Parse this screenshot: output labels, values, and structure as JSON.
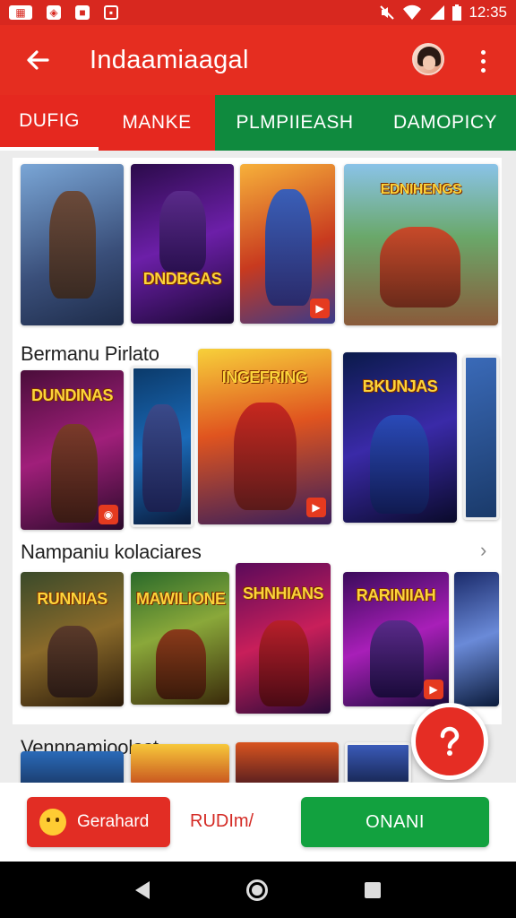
{
  "status_bar": {
    "time": "12:35",
    "left_icons": [
      "notification-icon-1",
      "notification-icon-2",
      "notification-icon-3",
      "image-icon"
    ],
    "right_icons": [
      "mute-icon",
      "wifi-icon",
      "signal-icon",
      "battery-icon"
    ]
  },
  "app_bar": {
    "title": "Indaamiaagal"
  },
  "tabs": [
    "DUFIG",
    "MANKE",
    "PLMPIIEASH",
    "DAMOPICY"
  ],
  "sections": {
    "row2_title": "Bermanu Pirlato",
    "row3_title": "Nampaniu kolaciares",
    "row4_title": "Vennnamioolast"
  },
  "tiles": [
    {
      "title": ""
    },
    {
      "title": "DNDBGAS"
    },
    {
      "title": ""
    },
    {
      "title": "EDNIHENGS"
    },
    {
      "title": "DUNDINAS"
    },
    {
      "title": ""
    },
    {
      "title": "INGEFRING"
    },
    {
      "title": "BKUNJAS"
    },
    {
      "title": ""
    },
    {
      "title": "RUNNIAS"
    },
    {
      "title": "MAWILIONE"
    },
    {
      "title": "SHNHIANS"
    },
    {
      "title": "RARINIIAH"
    },
    {
      "title": ""
    }
  ],
  "bottom_bar": {
    "left_button": "Gerahard",
    "mid_button": "RUDIm/",
    "right_button": "ONANI"
  },
  "colors": {
    "primary_red": "#e52d20",
    "tab_green": "#0f8a3e",
    "button_green": "#12a13f"
  }
}
